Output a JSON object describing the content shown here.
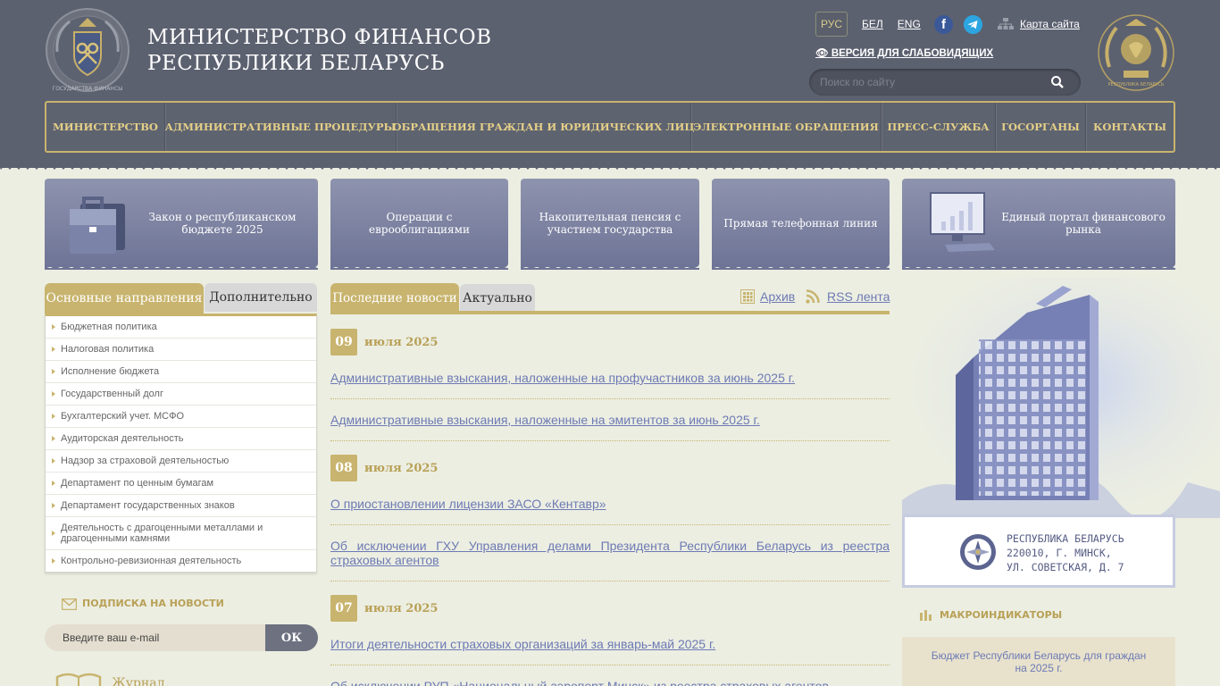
{
  "header": {
    "title_line1": "МИНИСТЕРСТВО ФИНАНСОВ",
    "title_line2": "РЕСПУБЛИКИ БЕЛАРУСЬ",
    "emblem_left_text": "ГОСУДАРСТВА ФИНАНСЫ",
    "emblem_right_text": "РЕСПУБЛИКА БЕЛАРУСЬ",
    "languages": [
      "РУС",
      "БЕЛ",
      "ENG"
    ],
    "sitemap_label": "Карта сайта",
    "vision_label": "ВЕРСИЯ ДЛЯ СЛАБОВИДЯЩИХ",
    "search_placeholder": "Поиск по сайту",
    "facebook_glyph": "f"
  },
  "nav": {
    "items": [
      {
        "label": "МИНИСТЕРСТВО"
      },
      {
        "label": "АДМИНИСТРАТИВНЫЕ ПРОЦЕДУРЫ"
      },
      {
        "label": "ОБРАЩЕНИЯ ГРАЖДАН И ЮРИДИЧЕСКИХ ЛИЦ"
      },
      {
        "label": "ЭЛЕКТРОННЫЕ ОБРАЩЕНИЯ"
      },
      {
        "label": "ПРЕСС-СЛУЖБА"
      },
      {
        "label": "ГОСОРГАНЫ"
      },
      {
        "label": "КОНТАКТЫ"
      }
    ]
  },
  "banners": [
    {
      "label": "Закон о республиканском бюджете 2025"
    },
    {
      "label": "Операции с еврооблигациями"
    },
    {
      "label": "Накопительная пенсия с участием государства"
    },
    {
      "label": "Прямая телефонная линия"
    },
    {
      "label": "Единый портал финансового рынка"
    }
  ],
  "left": {
    "tab_main": "Основные направления",
    "tab_extra": "Дополнительно",
    "menu": [
      "Бюджетная политика",
      "Налоговая политика",
      "Исполнение бюджета",
      "Государственный долг",
      "Бухгалтерский учет. МСФО",
      "Аудиторская деятельность",
      "Надзор за страховой деятельностью",
      "Департамент по ценным бумагам",
      "Департамент государственных знаков",
      "Деятельность с драгоценными металлами и драгоценными камнями",
      "Контрольно-ревизионная деятельность"
    ],
    "subscribe_title": "ПОДПИСКА НА НОВОСТИ",
    "email_placeholder": "Введите ваш e-mail",
    "ok_label": "ОК",
    "journal_label": "Журнал"
  },
  "news": {
    "tab_latest": "Последние новости",
    "tab_actual": "Актуально",
    "archive_label": "Архив",
    "rss_label": "RSS лента",
    "groups": [
      {
        "day": "09",
        "month": "июля 2025",
        "items": [
          "Административные взыскания, наложенные на профучастников за июнь 2025 г.",
          "Административные взыскания, наложенные на эмитентов за июнь 2025 г."
        ]
      },
      {
        "day": "08",
        "month": "июля 2025",
        "items": [
          "О приостановлении лицензии ЗАСО «Кентавр»",
          "Об исключении ГХУ Управления делами Президента Республики Беларусь из реестра страховых агентов"
        ]
      },
      {
        "day": "07",
        "month": "июля 2025",
        "items": [
          "Итоги деятельности страховых организаций за январь-май 2025 г.",
          "Об исключении РУП «Национальный аэропорт Минск» из реестра страховых агентов"
        ]
      }
    ]
  },
  "right": {
    "address_line1": "РЕСПУБЛИКА БЕЛАРУСЬ",
    "address_line2": "220010, г. МИНСК,",
    "address_line3": "ул. СОВЕТСКАЯ, д. 7",
    "macro_title": "МАКРОИНДИКАТОРЫ",
    "macro_link": "Бюджет Республики Беларусь для граждан на 2025 г."
  },
  "colors": {
    "header_bg": "#5c6170",
    "gold": "#c8b46e",
    "link": "#6d7ab4",
    "banner": "#7c82a3"
  }
}
